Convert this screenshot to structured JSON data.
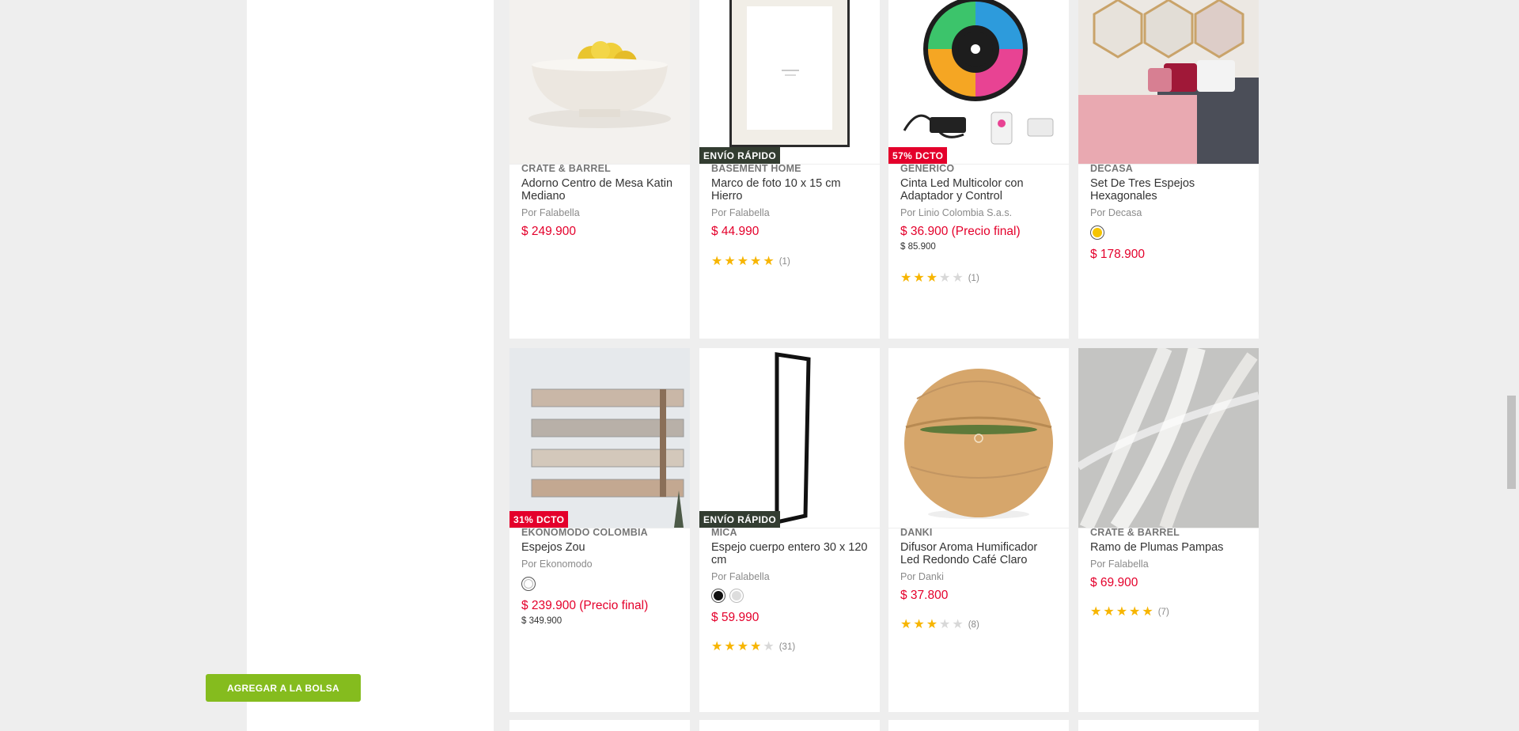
{
  "row1": [
    {
      "brand": "CRATE & BARREL",
      "title": "Adorno Centro de Mesa Katin Mediano",
      "seller": "Por Falabella",
      "price": "$ 249.900",
      "badge": ""
    },
    {
      "brand": "BASEMENT HOME",
      "title": "Marco de foto 10 x 15 cm Hierro",
      "seller": "Por Falabella",
      "price": "$ 44.990",
      "badge": "ENVÍO RÁPIDO",
      "rating_count": "(1)",
      "rating_stars": 5
    },
    {
      "brand": "GENERICO",
      "title": "Cinta Led Multicolor con Adaptador y Control",
      "seller": "Por Linio Colombia S.a.s.",
      "price": "$ 36.900 (Precio final)",
      "old_price": "$ 85.900",
      "badge": "57% DCTO",
      "rating_count": "(1)",
      "rating_stars": 3
    },
    {
      "brand": "DECASA",
      "title": "Set De Tres Espejos Hexagonales",
      "seller": "Por Decasa",
      "price": "$ 178.900",
      "badge": "",
      "swatch_colors": [
        "#f5c400"
      ]
    }
  ],
  "row2": [
    {
      "brand": "EKONOMODO COLOMBIA",
      "title": "Espejos Zou",
      "seller": "Por Ekonomodo",
      "price": "$ 239.900 (Precio final)",
      "old_price": "$ 349.900",
      "badge": "31% DCTO",
      "swatch_colors": [
        "#ffffff"
      ]
    },
    {
      "brand": "MICA",
      "title": "Espejo cuerpo entero 30 x 120 cm",
      "seller": "Por Falabella",
      "price": "$ 59.990",
      "badge": "ENVÍO RÁPIDO",
      "swatch_colors": [
        "#111111",
        "#dddddd"
      ],
      "rating_count": "(31)",
      "rating_stars": 3.5
    },
    {
      "brand": "DANKI",
      "title": "Difusor Aroma Humificador Led Redondo Café Claro",
      "seller": "Por Danki",
      "price": "$ 37.800",
      "badge": "",
      "rating_count": "(8)",
      "rating_stars": 3
    },
    {
      "brand": "CRATE & BARREL",
      "title": "Ramo de Plumas Pampas",
      "seller": "Por Falabella",
      "price": "$ 69.900",
      "badge": "",
      "rating_count": "(7)",
      "rating_stars": 5
    }
  ],
  "add_to_bag_label": "AGREGAR A LA BOLSA",
  "colors": {
    "price_red": "#e4002b",
    "fast_shipping_badge": "#333d31",
    "discount_badge": "#e4002b",
    "add_button_green": "#85bc1e",
    "star_yellow": "#f7b500"
  }
}
